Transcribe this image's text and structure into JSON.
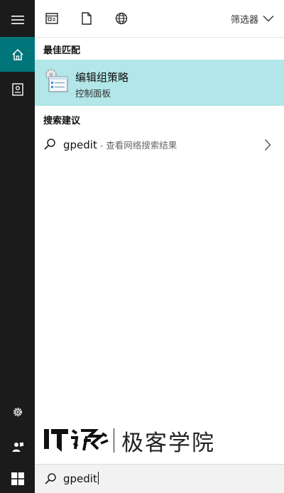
{
  "topbar": {
    "filter_label": "筛选器"
  },
  "best_match": {
    "section_label": "最佳匹配",
    "title": "编辑组策略",
    "subtitle": "控制面板"
  },
  "suggestions": {
    "section_label": "搜索建议",
    "items": [
      {
        "query": "gpedit",
        "hint": " - 查看网络搜索结果"
      }
    ]
  },
  "watermark": {
    "brand_text": "极客学院"
  },
  "search": {
    "value": "gpedit"
  },
  "colors": {
    "rail_bg": "#1b1b1b",
    "rail_active": "#00767a",
    "best_match_bg": "#b2e6e9"
  }
}
